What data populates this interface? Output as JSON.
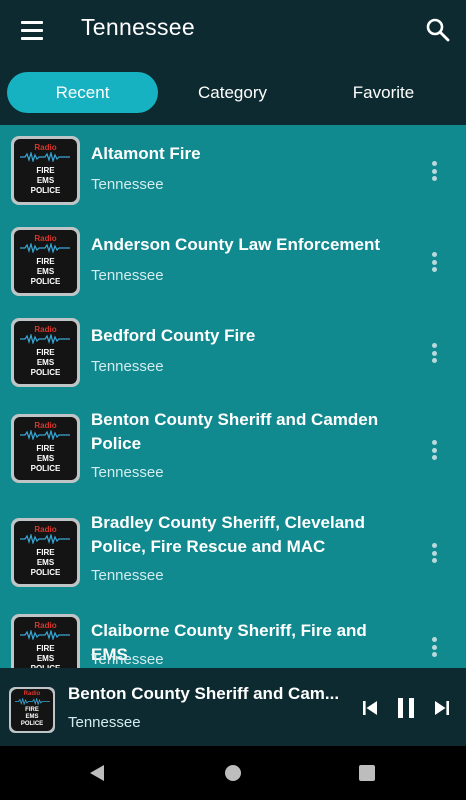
{
  "header": {
    "title": "Tennessee"
  },
  "tabs": [
    {
      "label": "Recent",
      "active": true
    },
    {
      "label": "Category",
      "active": false
    },
    {
      "label": "Favorite",
      "active": false
    }
  ],
  "thumbnail": {
    "radio": "Radio",
    "fire": "FIRE",
    "ems": "EMS",
    "police": "POLICE"
  },
  "stations": [
    {
      "title": "Altamont Fire",
      "subtitle": "Tennessee"
    },
    {
      "title": "Anderson County Law Enforcement",
      "subtitle": "Tennessee"
    },
    {
      "title": "Bedford County Fire",
      "subtitle": "Tennessee"
    },
    {
      "title": "Benton County Sheriff and Camden Police",
      "subtitle": "Tennessee"
    },
    {
      "title": "Bradley County Sheriff, Cleveland Police, Fire Rescue and MAC",
      "subtitle": "Tennessee"
    },
    {
      "title": "Claiborne County Sheriff, Fire and EMS",
      "subtitle": "Tennessee"
    }
  ],
  "player": {
    "title": "Benton County Sheriff and Cam...",
    "subtitle": "Tennessee",
    "state": "playing"
  },
  "colors": {
    "background": "#10898f",
    "bar": "#0d2a30",
    "accent": "#17b2c1"
  },
  "icons": [
    "menu-icon",
    "search-icon",
    "more-vert-icon",
    "skip-previous-icon",
    "pause-icon",
    "skip-next-icon",
    "nav-back-icon",
    "nav-home-icon",
    "nav-recents-icon"
  ]
}
